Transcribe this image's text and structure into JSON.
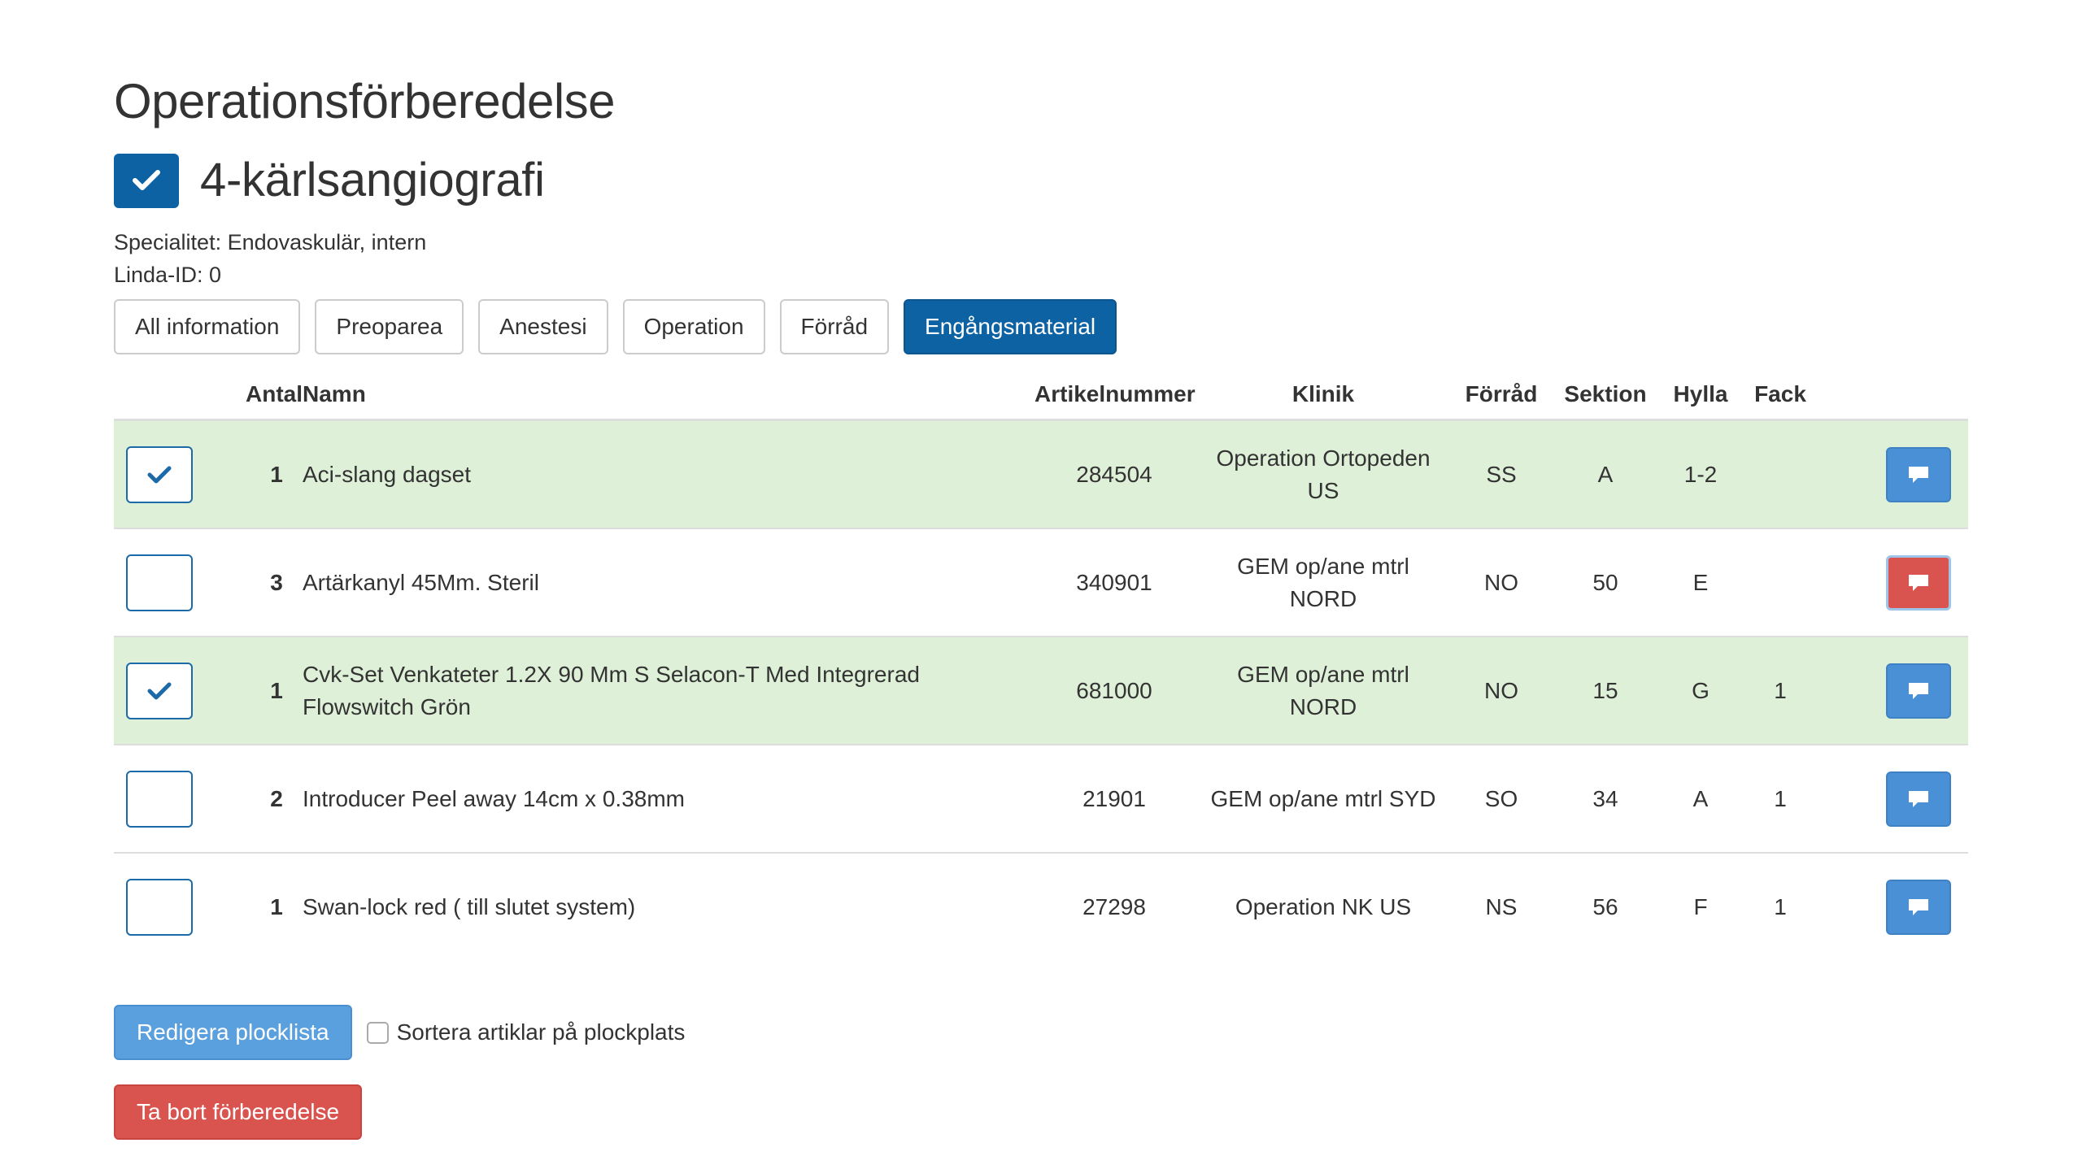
{
  "header": {
    "title": "Operationsförberedelse",
    "procedure": "4-kärlsangiografi",
    "procedure_checked": true,
    "specialty": "Specialitet: Endovaskulär, intern",
    "linda_id": "Linda-ID: 0"
  },
  "tabs": [
    {
      "label": "All information",
      "active": false
    },
    {
      "label": "Preoparea",
      "active": false
    },
    {
      "label": "Anestesi",
      "active": false
    },
    {
      "label": "Operation",
      "active": false
    },
    {
      "label": "Förråd",
      "active": false
    },
    {
      "label": "Engångsmaterial",
      "active": true
    }
  ],
  "table": {
    "headers": {
      "antal": "Antal",
      "namn": "Namn",
      "artikelnummer": "Artikelnummer",
      "klinik": "Klinik",
      "forrad": "Förråd",
      "sektion": "Sektion",
      "hylla": "Hylla",
      "fack": "Fack"
    },
    "rows": [
      {
        "checked": true,
        "antal": "1",
        "namn": "Aci-slang dagset",
        "artikelnummer": "284504",
        "klinik_line1": "Operation Ortopeden",
        "klinik_line2": "US",
        "forrad": "SS",
        "sektion": "A",
        "hylla": "1-2",
        "fack": "",
        "comment_alert": false
      },
      {
        "checked": false,
        "antal": "3",
        "namn": "Artärkanyl 45Mm. Steril",
        "artikelnummer": "340901",
        "klinik_line1": "GEM op/ane mtrl",
        "klinik_line2": "NORD",
        "forrad": "NO",
        "sektion": "50",
        "hylla": "E",
        "fack": "",
        "comment_alert": true
      },
      {
        "checked": true,
        "antal": "1",
        "namn": "Cvk-Set Venkateter 1.2X 90 Mm S Selacon-T Med Integrerad Flowswitch Grön",
        "artikelnummer": "681000",
        "klinik_line1": "GEM op/ane mtrl",
        "klinik_line2": "NORD",
        "forrad": "NO",
        "sektion": "15",
        "hylla": "G",
        "fack": "1",
        "comment_alert": false
      },
      {
        "checked": false,
        "antal": "2",
        "namn": "Introducer Peel away 14cm x 0.38mm",
        "artikelnummer": "21901",
        "klinik_line1": "GEM op/ane mtrl SYD",
        "klinik_line2": "",
        "forrad": "SO",
        "sektion": "34",
        "hylla": "A",
        "fack": "1",
        "comment_alert": false
      },
      {
        "checked": false,
        "antal": "1",
        "namn": "Swan-lock red ( till slutet system)",
        "artikelnummer": "27298",
        "klinik_line1": "Operation NK US",
        "klinik_line2": "",
        "forrad": "NS",
        "sektion": "56",
        "hylla": "F",
        "fack": "1",
        "comment_alert": false
      }
    ]
  },
  "actions": {
    "edit_label": "Redigera plocklista",
    "sort_label": "Sortera artiklar på plockplats",
    "sort_checked": false,
    "delete_label": "Ta bort förberedelse"
  },
  "icons": {
    "check": "check-icon",
    "comment": "comment-icon"
  },
  "colors": {
    "primary": "#0d62a4",
    "info": "#4a90d6",
    "danger": "#d9534f",
    "success_row": "#dff0d8",
    "check_mark": "#1c6ba8"
  }
}
